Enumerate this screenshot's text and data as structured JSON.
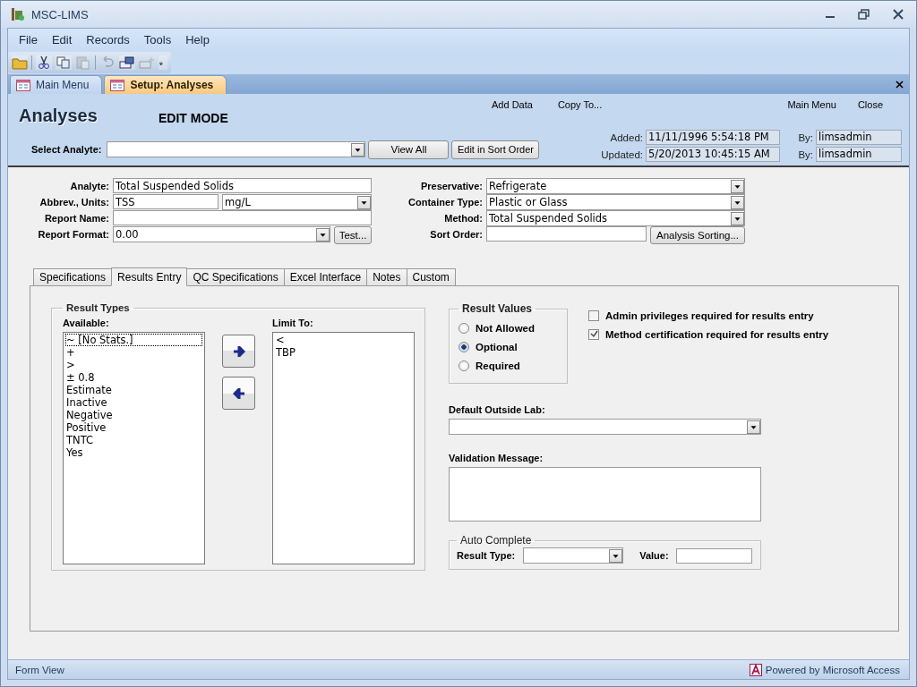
{
  "window": {
    "title": "MSC-LIMS"
  },
  "menu": [
    "File",
    "Edit",
    "Records",
    "Tools",
    "Help"
  ],
  "toolbar": [
    {
      "kind": "open",
      "disabled": false
    },
    {
      "kind": "separator"
    },
    {
      "kind": "cut",
      "disabled": false
    },
    {
      "kind": "copy",
      "disabled": false
    },
    {
      "kind": "paste",
      "disabled": true
    },
    {
      "kind": "separator"
    },
    {
      "kind": "undo",
      "disabled": true
    },
    {
      "kind": "form",
      "disabled": false
    },
    {
      "kind": "new-form",
      "disabled": true
    },
    {
      "kind": "more",
      "disabled": false
    }
  ],
  "document_tabs": [
    {
      "label": "Main Menu",
      "selected": false
    },
    {
      "label": "Setup: Analyses",
      "selected": true
    }
  ],
  "form_header": {
    "title": "Analyses",
    "mode": "EDIT MODE",
    "links": [
      "Add Data",
      "Copy To..."
    ],
    "nav_links": [
      "Main Menu",
      "Close"
    ],
    "select_label": "Select Analyte:",
    "buttons": [
      "View All",
      "Edit in Sort Order"
    ],
    "audit": [
      {
        "label": "Added:",
        "value": "11/11/1996 5:54:18 PM",
        "by_label": "By:",
        "by": "limsadmin"
      },
      {
        "label": "Updated:",
        "value": "5/20/2013 10:45:15 AM",
        "by_label": "By:",
        "by": "limsadmin"
      }
    ]
  },
  "fields_left": [
    {
      "label": "Analyte:",
      "kind": "text",
      "value": "Total Suspended Solids"
    },
    {
      "label": "Abbrev., Units:",
      "kind": "pair",
      "value": "TSS",
      "value2": "mg/L"
    },
    {
      "label": "Report Name:",
      "kind": "text"
    },
    {
      "label": "Report Format:",
      "kind": "combo_button",
      "value": "0.00",
      "button": "Test..."
    }
  ],
  "fields_right": [
    {
      "label": "Preservative:",
      "kind": "combo",
      "value": "Refrigerate"
    },
    {
      "label": "Container Type:",
      "kind": "combo",
      "value": "Plastic or Glass"
    },
    {
      "label": "Method:",
      "kind": "combo",
      "value": "Total Suspended Solids"
    },
    {
      "label": "Sort Order:",
      "kind": "text_button",
      "button": "Analysis Sorting..."
    }
  ],
  "tabs": [
    {
      "label": "Specifications",
      "selected": false
    },
    {
      "label": "Results Entry",
      "selected": true
    },
    {
      "label": "QC Specifications",
      "selected": false
    },
    {
      "label": "Excel Interface",
      "selected": false
    },
    {
      "label": "Notes",
      "selected": false
    },
    {
      "label": "Custom",
      "selected": false
    }
  ],
  "result_types": {
    "title": "Result Types",
    "available_label": "Available:",
    "available": [
      {
        "text": "~ [No Stats.]",
        "selected": true
      },
      {
        "text": "+",
        "selected": false
      },
      {
        "text": ">",
        "selected": false
      },
      {
        "text": "± 0.8",
        "selected": false
      },
      {
        "text": "Estimate",
        "selected": false
      },
      {
        "text": "Inactive",
        "selected": false
      },
      {
        "text": "Negative",
        "selected": false
      },
      {
        "text": "Positive",
        "selected": false
      },
      {
        "text": "TNTC",
        "selected": false
      },
      {
        "text": "Yes",
        "selected": false
      }
    ],
    "limit_label": "Limit To:",
    "limit_to": [
      "<",
      "TBP"
    ]
  },
  "result_values": {
    "title": "Result Values",
    "options": [
      {
        "label": "Not Allowed",
        "selected": false
      },
      {
        "label": "Optional",
        "selected": true
      },
      {
        "label": "Required",
        "selected": false
      }
    ]
  },
  "checkboxes": [
    {
      "label": "Admin privileges required for results entry",
      "checked": false
    },
    {
      "label": "Method certification required for results entry",
      "checked": true
    }
  ],
  "default_outside_lab": {
    "label": "Default Outside Lab:"
  },
  "validation_message": {
    "label": "Validation Message:"
  },
  "auto_complete": {
    "title": "Auto Complete",
    "result_type_label": "Result Type:",
    "value_label": "Value:"
  },
  "status_bar": {
    "left": "Form View",
    "right": "Powered by Microsoft Access"
  }
}
